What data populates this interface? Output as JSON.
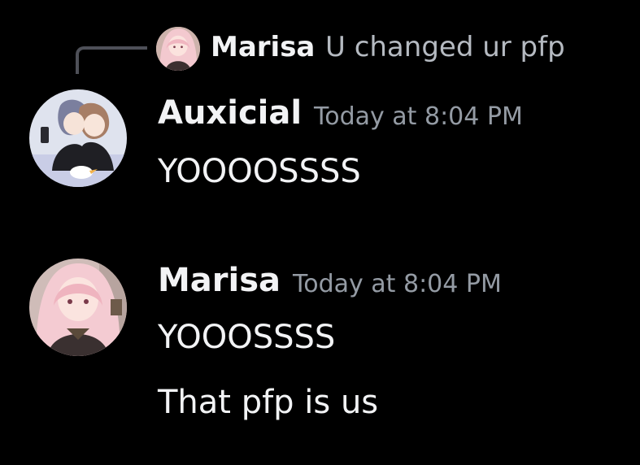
{
  "reply": {
    "author": "Marisa",
    "text": "U changed ur pfp"
  },
  "messages": [
    {
      "author": "Auxicial",
      "timestamp": "Today at 8:04 PM",
      "lines": [
        "YOOOOSSSS"
      ]
    },
    {
      "author": "Marisa",
      "timestamp": "Today at 8:04 PM",
      "lines": [
        "YOOOSSSS",
        "That pfp is us"
      ]
    }
  ],
  "colors": {
    "background": "#000000",
    "author": "#f2f3f5",
    "timestamp": "#949ba4",
    "reply_text": "#b5bac1",
    "connector": "#4e5058"
  }
}
